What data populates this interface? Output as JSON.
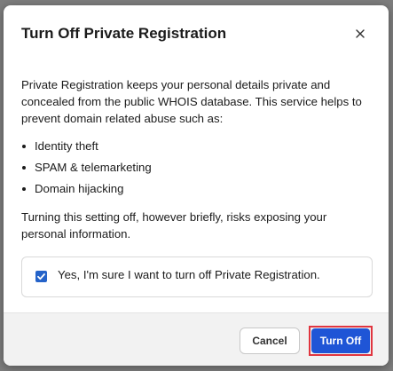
{
  "dialog": {
    "title": "Turn Off Private Registration",
    "close_icon": "close-icon"
  },
  "body": {
    "intro": "Private Registration keeps your personal details private and concealed from the public WHOIS database. This service helps to prevent domain related abuse such as:",
    "bullets": [
      "Identity theft",
      "SPAM & telemarketing",
      "Domain hijacking"
    ],
    "warning": "Turning this setting off, however briefly, risks exposing your personal information."
  },
  "confirmation": {
    "checked": true,
    "label": "Yes, I'm sure I want to turn off Private Registration.",
    "checkbox_color": "#2563c9"
  },
  "footer": {
    "cancel_label": "Cancel",
    "turn_off_label": "Turn Off",
    "primary_color": "#1f55d6",
    "highlight_color": "#e0353f"
  }
}
